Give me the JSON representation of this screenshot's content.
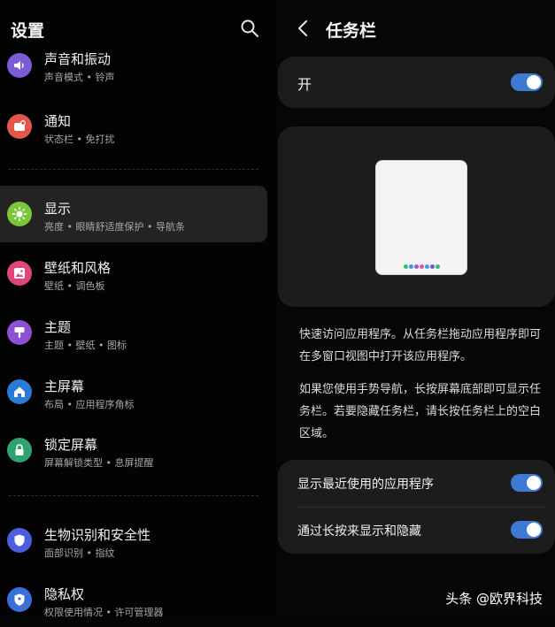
{
  "left": {
    "title": "设置",
    "items": [
      {
        "title": "声音和振动",
        "subtitle": "声音模式 • 铃声",
        "icon": "speaker-icon",
        "color": "#7b5bd6"
      },
      {
        "title": "通知",
        "subtitle": "状态栏 • 免打扰",
        "icon": "notification-icon",
        "color": "#e2564c"
      },
      {
        "title": "显示",
        "subtitle": "亮度 • 眼睛舒适度保护 • 导航条",
        "icon": "brightness-icon",
        "color": "#7cc63a",
        "selected": true
      },
      {
        "title": "壁纸和风格",
        "subtitle": "壁纸 • 调色板",
        "icon": "wallpaper-icon",
        "color": "#e0467a"
      },
      {
        "title": "主题",
        "subtitle": "主题 • 壁纸 • 图标",
        "icon": "theme-brush-icon",
        "color": "#8d4fd4"
      },
      {
        "title": "主屏幕",
        "subtitle": "布局 • 应用程序角标",
        "icon": "home-icon",
        "color": "#2a7bd8"
      },
      {
        "title": "锁定屏幕",
        "subtitle": "屏幕解锁类型 • 息屏提醒",
        "icon": "lock-icon",
        "color": "#2fa36f"
      },
      {
        "title": "生物识别和安全性",
        "subtitle": "面部识别 • 指纹",
        "icon": "shield-icon",
        "color": "#4b5fdc"
      },
      {
        "title": "隐私权",
        "subtitle": "权限使用情况 • 许可管理器",
        "icon": "privacy-icon",
        "color": "#3a6fd8"
      }
    ]
  },
  "right": {
    "title": "任务栏",
    "master_label": "开",
    "master_on": true,
    "description_1": "快速访问应用程序。从任务栏拖动应用程序即可在多窗口视图中打开该应用程序。",
    "description_2": "如果您使用手势导航，长按屏幕底部即可显示任务栏。若要隐藏任务栏，请长按任务栏上的空白区域。",
    "options": [
      {
        "label": "显示最近使用的应用程序",
        "on": true
      },
      {
        "label": "通过长按来显示和隐藏",
        "on": true
      }
    ],
    "dock_colors": [
      "#2fbf71",
      "#4a90e2",
      "#9b59d6",
      "#e056a0",
      "#3aa0e0",
      "#6a5acd",
      "#2fbf71"
    ],
    "accent": "#3e7ad4"
  },
  "watermark": "头条 @欧界科技"
}
